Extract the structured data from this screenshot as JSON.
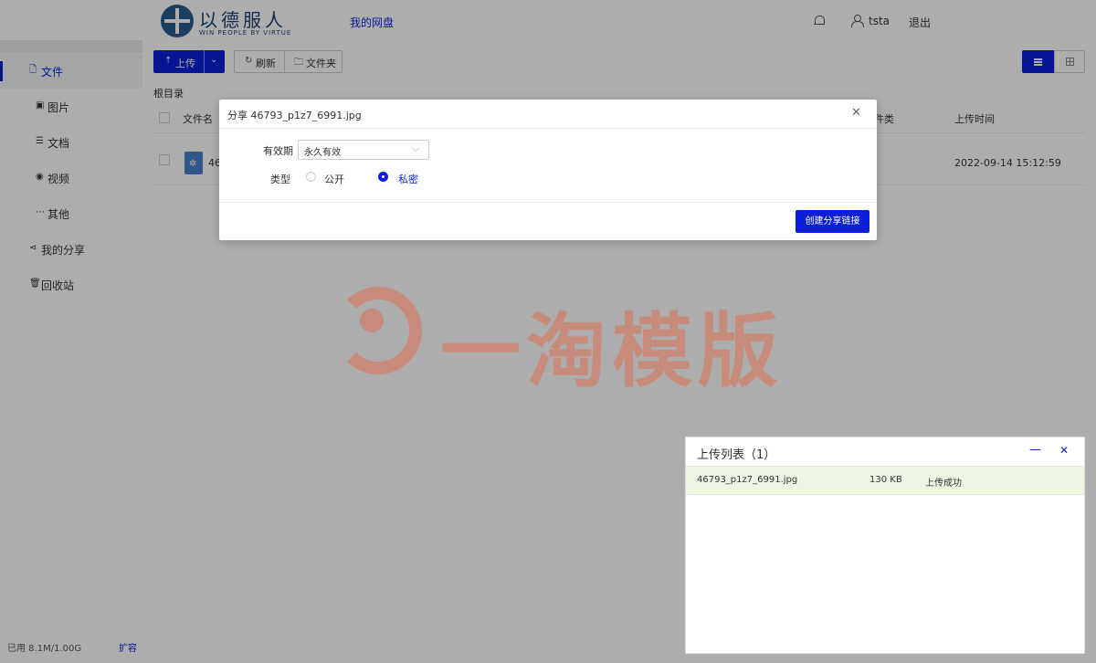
{
  "header": {
    "logo_cn": "以德服人",
    "logo_en": "WIN PEOPLE BY VIRTUE",
    "nav_pan": "我的网盘",
    "username": "tsta",
    "logout": "退出"
  },
  "sidebar": {
    "items": [
      {
        "icon": "file-icon",
        "label": "文件"
      },
      {
        "icon": "image-icon",
        "label": "图片"
      },
      {
        "icon": "document-icon",
        "label": "文档"
      },
      {
        "icon": "video-icon",
        "label": "视频"
      },
      {
        "icon": "more-icon",
        "label": "其他"
      },
      {
        "icon": "share-icon",
        "label": "我的分享"
      },
      {
        "icon": "trash-icon",
        "label": "回收站"
      }
    ],
    "storage": "已用 8.1M/1.00G",
    "expand": "扩容"
  },
  "toolbar": {
    "upload": "上传",
    "refresh": "刷新",
    "folder": "文件夹"
  },
  "breadcrumb": "根目录",
  "table": {
    "columns": {
      "name": "文件名",
      "type": "件类",
      "time": "上传时间"
    },
    "rows": [
      {
        "name": "46",
        "time": "2022-09-14 15:12:59"
      }
    ]
  },
  "watermark": "一淘模版",
  "dialog": {
    "title": "分享 46793_p1z7_6991.jpg",
    "validity_label": "有效期",
    "validity_value": "永久有效",
    "type_label": "类型",
    "options": [
      "公开",
      "私密"
    ],
    "selected": "私密",
    "create_button": "创建分享链接"
  },
  "upload_panel": {
    "title": "上传列表（1）",
    "items": [
      {
        "name": "46793_p1z7_6991.jpg",
        "size": "130 KB",
        "status": "上传成功"
      }
    ]
  },
  "colors": {
    "accent": "#0b1fd9",
    "success_row": "#eef6e2",
    "watermark": "#e06a4a"
  }
}
